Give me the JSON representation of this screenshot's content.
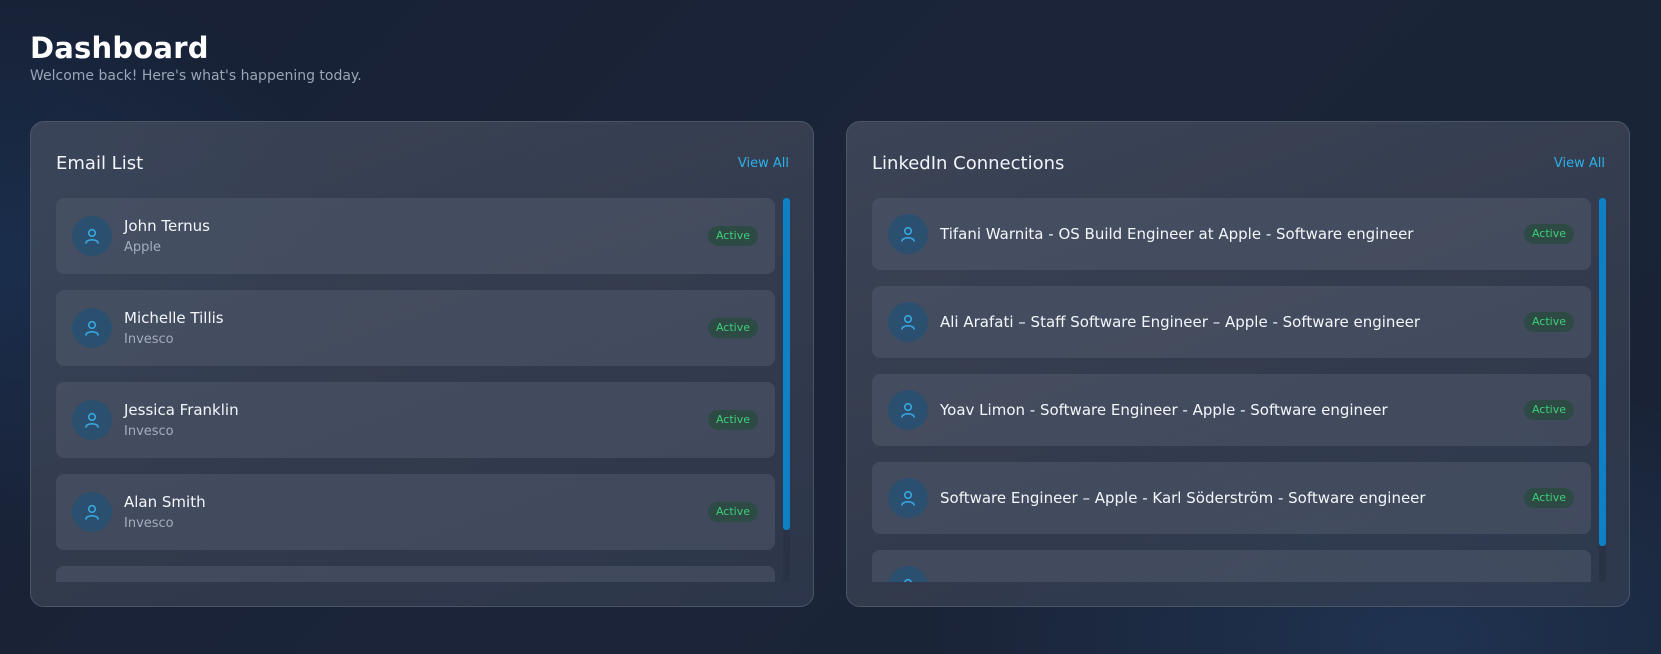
{
  "header": {
    "title": "Dashboard",
    "subtitle": "Welcome back! Here's what's happening today."
  },
  "email_panel": {
    "title": "Email List",
    "view_all": "View All",
    "items": [
      {
        "name": "John Ternus",
        "company": "Apple",
        "status": "Active"
      },
      {
        "name": "Michelle Tillis",
        "company": "Invesco",
        "status": "Active"
      },
      {
        "name": "Jessica Franklin",
        "company": "Invesco",
        "status": "Active"
      },
      {
        "name": "Alan Smith",
        "company": "Invesco",
        "status": "Active"
      }
    ]
  },
  "linkedin_panel": {
    "title": "LinkedIn Connections",
    "view_all": "View All",
    "items": [
      {
        "text": "Tifani Warnita - OS Build Engineer at Apple - Software engineer",
        "status": "Active"
      },
      {
        "text": "Ali Arafati – Staff Software Engineer – Apple - Software engineer",
        "status": "Active"
      },
      {
        "text": "Yoav Limon - Software Engineer - Apple - Software engineer",
        "status": "Active"
      },
      {
        "text": "Software Engineer – Apple - Karl Söderström - Software engineer",
        "status": "Active"
      }
    ]
  },
  "icons": {
    "avatar": "user-icon"
  },
  "colors": {
    "accent": "#2cb0e8",
    "status_active": "#3ecf7a",
    "scrollbar": "#0f7fc6"
  }
}
